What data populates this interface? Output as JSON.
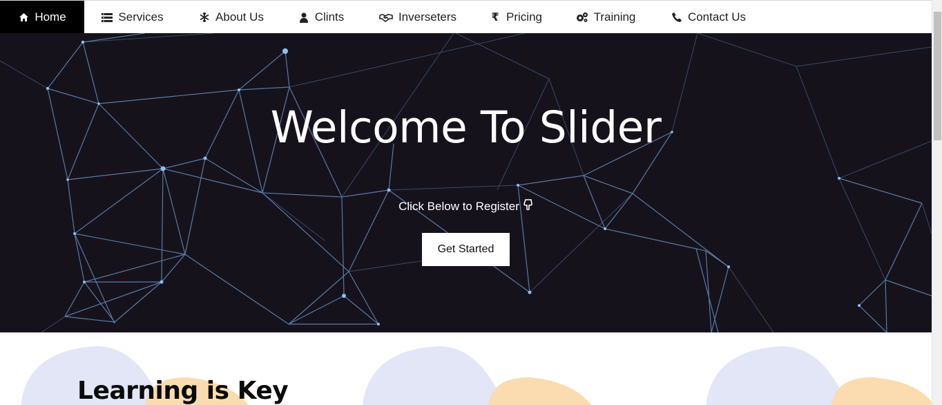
{
  "nav": {
    "items": [
      {
        "label": "Home",
        "icon": "home-icon",
        "active": true
      },
      {
        "label": "Services",
        "icon": "list-icon",
        "active": false
      },
      {
        "label": "About Us",
        "icon": "snowflake-icon",
        "active": false
      },
      {
        "label": "Clints",
        "icon": "user-icon",
        "active": false
      },
      {
        "label": "Inverseters",
        "icon": "handshake-icon",
        "active": false
      },
      {
        "label": "Pricing",
        "icon": "rupee-icon",
        "active": false
      },
      {
        "label": "Training",
        "icon": "gears-icon",
        "active": false
      },
      {
        "label": "Contact Us",
        "icon": "phone-icon",
        "active": false
      }
    ]
  },
  "hero": {
    "title": "Welcome To Slider",
    "subtitle": "Click Below to Register",
    "subtitle_icon": "hand-pointing-down-icon",
    "button_label": "Get Started",
    "background_color": "#16121c",
    "line_color": "#7fb3e6"
  },
  "section": {
    "title": "Learning is Key",
    "blob_colors": [
      "#e2e6f7",
      "#fbdcb0"
    ]
  }
}
